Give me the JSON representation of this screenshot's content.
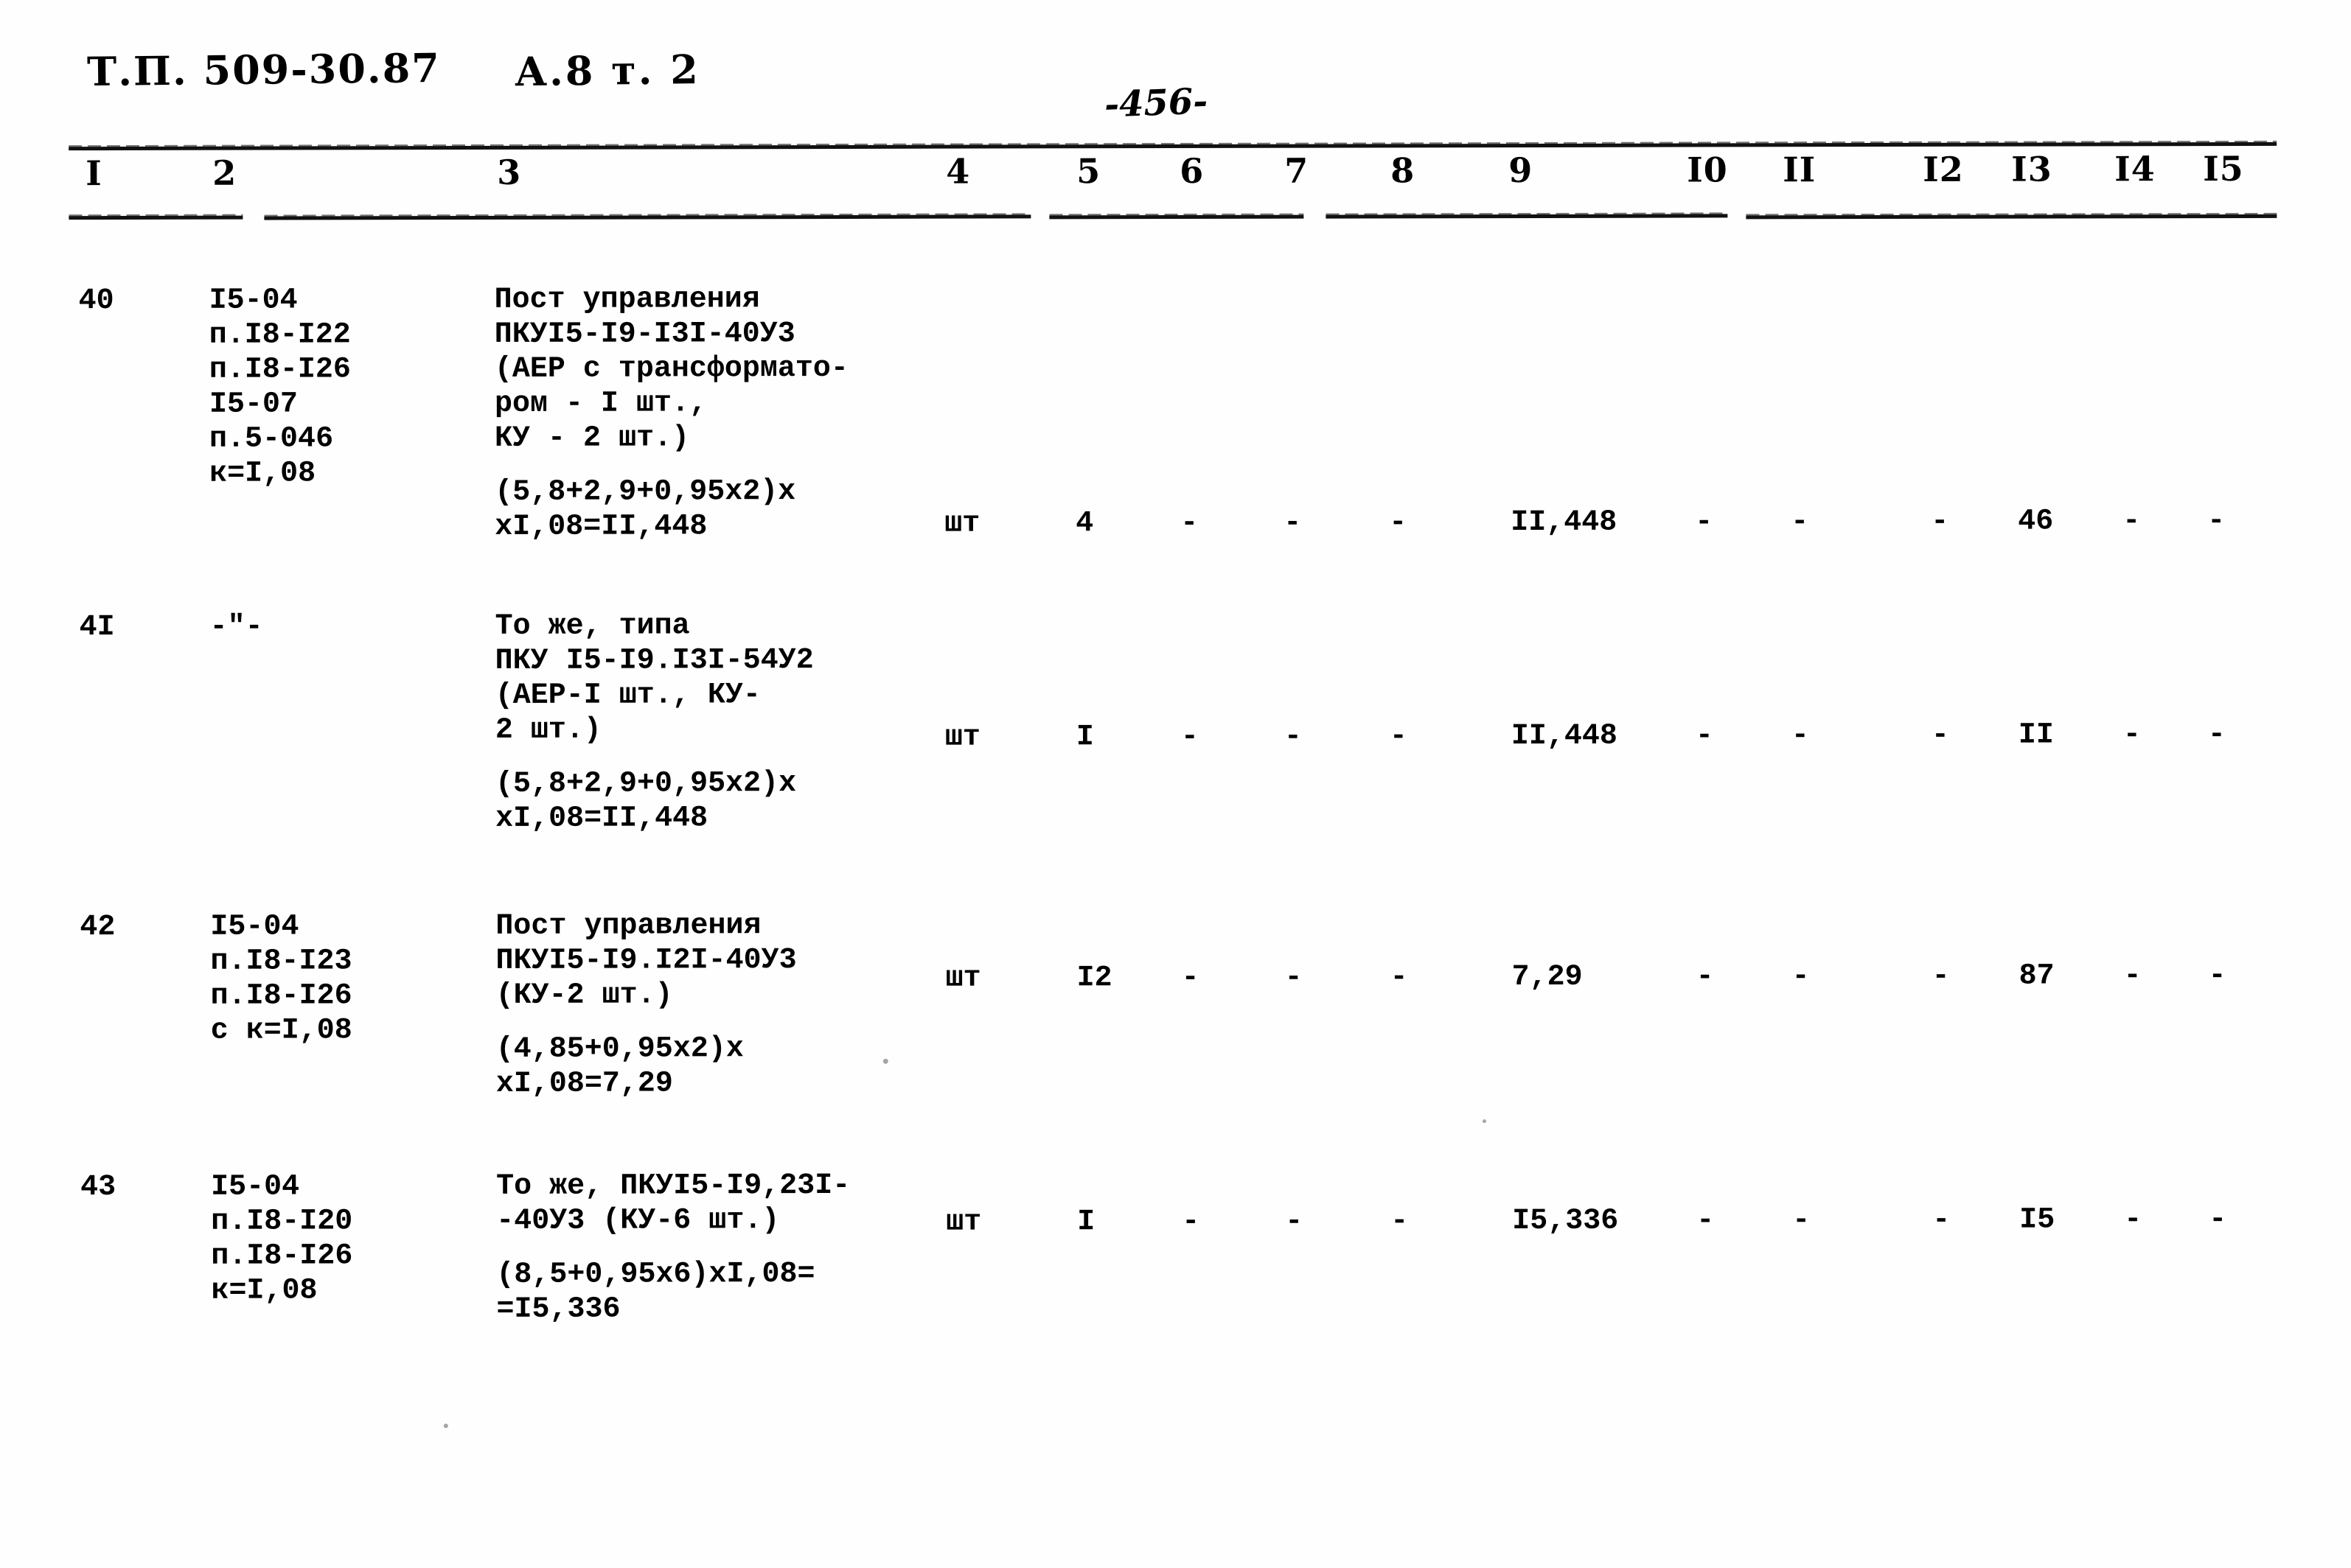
{
  "header": {
    "doc_code": "Т.П. 509-30.87",
    "album": "А.8 т. 2",
    "page_number": "-456-"
  },
  "table": {
    "column_headers": [
      "I",
      "2",
      "3",
      "4",
      "5",
      "6",
      "7",
      "8",
      "9",
      "I0",
      "II",
      "I2",
      "I3",
      "I4",
      "I5"
    ],
    "rows": [
      {
        "c1": "40",
        "c2": "I5-04\nп.I8-I22\nп.I8-I26\nI5-07\nп.5-046\nк=I,08",
        "c3": "Пост управления\nПКУI5-I9-I3I-40У3\n(АЕР с трансформато-\nром - I шт.,\nКУ - 2 шт.)",
        "c3_formula": "(5,8+2,9+0,95х2)х\nхI,08=II,448",
        "c4": "шт",
        "c5": "4",
        "c6": "-",
        "c7": "-",
        "c8": "-",
        "c9": "II,448",
        "c10": "-",
        "c11": "-",
        "c12": "-",
        "c13": "46",
        "c14": "-",
        "c15": "-"
      },
      {
        "c1": "4I",
        "c2": "-\"-",
        "c3": "То же, типа\nПКУ I5-I9.I3I-54У2\n(АЕР-I шт., КУ-\n2 шт.)",
        "c3_formula": "(5,8+2,9+0,95х2)х\nхI,08=II,448",
        "c4": "шт",
        "c5": "I",
        "c6": "-",
        "c7": "-",
        "c8": "-",
        "c9": "II,448",
        "c10": "-",
        "c11": "-",
        "c12": "-",
        "c13": "II",
        "c14": "-",
        "c15": "-"
      },
      {
        "c1": "42",
        "c2": "I5-04\nп.I8-I23\nп.I8-I26\nс к=I,08",
        "c3": "Пост управления\nПКУI5-I9.I2I-40У3\n(КУ-2 шт.)",
        "c3_formula": "(4,85+0,95х2)х\nхI,08=7,29",
        "c4": "шт",
        "c5": "I2",
        "c6": "-",
        "c7": "-",
        "c8": "-",
        "c9": "7,29",
        "c10": "-",
        "c11": "-",
        "c12": "-",
        "c13": "87",
        "c14": "-",
        "c15": "-"
      },
      {
        "c1": "43",
        "c2": "I5-04\nп.I8-I20\nп.I8-I26\nк=I,08",
        "c3": "То же, ПКУI5-I9,23I-\n-40У3 (КУ-6 шт.)",
        "c3_formula": "(8,5+0,95х6)хI,08=\n=I5,336",
        "c4": "шт",
        "c5": "I",
        "c6": "-",
        "c7": "-",
        "c8": "-",
        "c9": "I5,336",
        "c10": "-",
        "c11": "-",
        "c12": "-",
        "c13": "I5",
        "c14": "-",
        "c15": "-"
      }
    ]
  }
}
